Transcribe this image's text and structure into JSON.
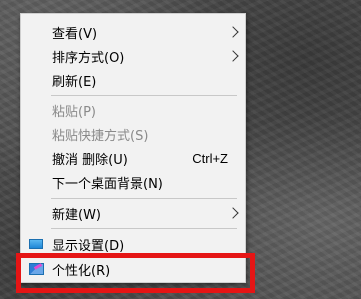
{
  "context_menu": {
    "items": [
      {
        "label": "查看(V)",
        "submenu": true,
        "disabled": false
      },
      {
        "label": "排序方式(O)",
        "submenu": true,
        "disabled": false
      },
      {
        "label": "刷新(E)",
        "submenu": false,
        "disabled": false
      },
      {
        "label": "粘贴(P)",
        "submenu": false,
        "disabled": true
      },
      {
        "label": "粘贴快捷方式(S)",
        "submenu": false,
        "disabled": true
      },
      {
        "label": "撤消 删除(U)",
        "shortcut": "Ctrl+Z",
        "submenu": false,
        "disabled": false
      },
      {
        "label": "下一个桌面背景(N)",
        "submenu": false,
        "disabled": false
      },
      {
        "label": "新建(W)",
        "submenu": true,
        "disabled": false
      },
      {
        "label": "显示设置(D)",
        "icon": "display-settings-icon",
        "submenu": false,
        "disabled": false
      },
      {
        "label": "个性化(R)",
        "icon": "personalize-icon",
        "submenu": false,
        "disabled": false,
        "highlighted": true
      }
    ]
  },
  "colors": {
    "menu_background": "#f2f2f2",
    "disabled_text": "#8a8a8a",
    "highlight_border": "#e51515"
  }
}
